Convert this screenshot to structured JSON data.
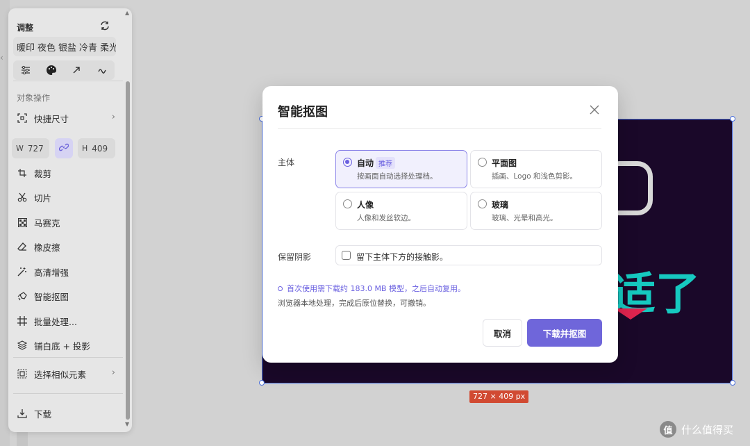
{
  "panel": {
    "title": "调整",
    "presets": [
      "暖印",
      "夜色",
      "银盐",
      "冷青",
      "柔光"
    ],
    "tools": [
      "sliders-icon",
      "palette-icon",
      "arrow-icon",
      "curve-icon"
    ],
    "section_label": "对象操作",
    "quick_size": "快捷尺寸",
    "width_label": "W",
    "width_value": "727",
    "height_label": "H",
    "height_value": "409",
    "items": {
      "crop": "裁剪",
      "slice": "切片",
      "mosaic": "马赛克",
      "eraser": "橡皮擦",
      "enhance": "高清增强",
      "cutout": "智能抠图",
      "batch": "批量处理...",
      "backdrop": "铺白底 + 投影",
      "select_similar": "选择相似元素",
      "download": "下载"
    }
  },
  "canvas": {
    "size_badge": "727 × 409 px",
    "glyph": "适了"
  },
  "modal": {
    "title": "智能抠图",
    "subject_label": "主体",
    "options": [
      {
        "title": "自动",
        "tag": "推荐",
        "desc": "按画面自动选择处理档。",
        "selected": true
      },
      {
        "title": "平面图",
        "desc": "插画、Logo 和浅色剪影。",
        "selected": false
      },
      {
        "title": "人像",
        "desc": "人像和发丝软边。",
        "selected": false
      },
      {
        "title": "玻璃",
        "desc": "玻璃、光晕和高光。",
        "selected": false
      }
    ],
    "shadow_label": "保留阴影",
    "shadow_checkbox": "留下主体下方的接触影。",
    "info_download": "首次使用需下载约 183.0 MB 模型，之后自动复用。",
    "info_local": "浏览器本地处理，完成后原位替换，可撤销。",
    "cancel": "取消",
    "confirm": "下载并抠图"
  },
  "watermark": {
    "logo": "值",
    "text": "什么值得买"
  },
  "colors": {
    "accent": "#6f66da",
    "selection": "#4a6fdc",
    "badge": "#d14a32"
  }
}
